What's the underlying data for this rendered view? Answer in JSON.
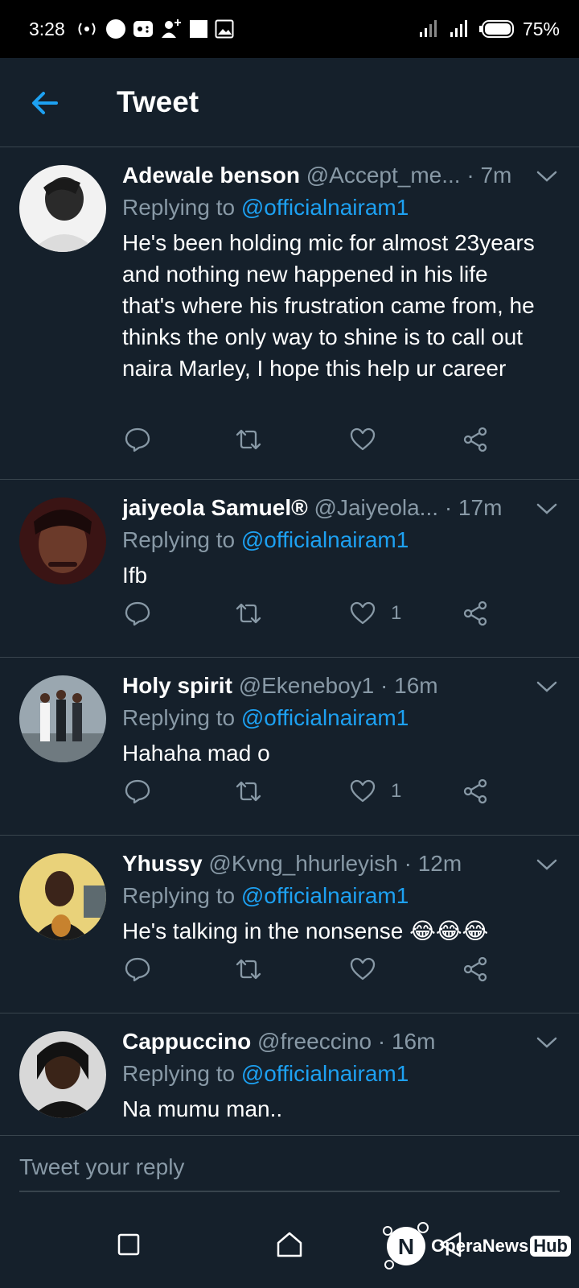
{
  "status_bar": {
    "time": "3:28",
    "battery_pct": "75%"
  },
  "header": {
    "title": "Tweet"
  },
  "tweets": [
    {
      "name": "Adewale benson",
      "handle": "@Accept_me...",
      "time": "7m",
      "replying_prefix": "Replying to",
      "replying_to": "@officialnairam1",
      "text": "He's been holding mic for almost 23years and nothing new happened in his life that's where his frustration came from, he thinks the only way to shine is to call out naira Marley, I hope this help ur career",
      "likes": ""
    },
    {
      "name": "jaiyeola Samuel®",
      "handle": "@Jaiyeola...",
      "time": "17m",
      "replying_prefix": "Replying to",
      "replying_to": "@officialnairam1",
      "text": "Ifb",
      "likes": "1"
    },
    {
      "name": "Holy spirit",
      "handle": "@Ekeneboy1",
      "time": "16m",
      "replying_prefix": "Replying to",
      "replying_to": "@officialnairam1",
      "text": "Hahaha mad o",
      "likes": "1"
    },
    {
      "name": "Yhussy",
      "handle": "@Kvng_hhurleyish",
      "time": "12m",
      "replying_prefix": "Replying to",
      "replying_to": "@officialnairam1",
      "text": "He's talking in the nonsense 😂😂😂",
      "likes": ""
    },
    {
      "name": "Cappuccino",
      "handle": "@freeccino",
      "time": "16m",
      "replying_prefix": "Replying to",
      "replying_to": "@officialnairam1",
      "text": "Na mumu man..",
      "likes": ""
    }
  ],
  "reply": {
    "placeholder": "Tweet your reply"
  },
  "watermark": {
    "brand": "OperaNews",
    "suffix": "Hub"
  },
  "colors": {
    "background": "#15202b",
    "accent": "#1da1f2",
    "muted": "#8899a6",
    "divider": "#38444d"
  }
}
